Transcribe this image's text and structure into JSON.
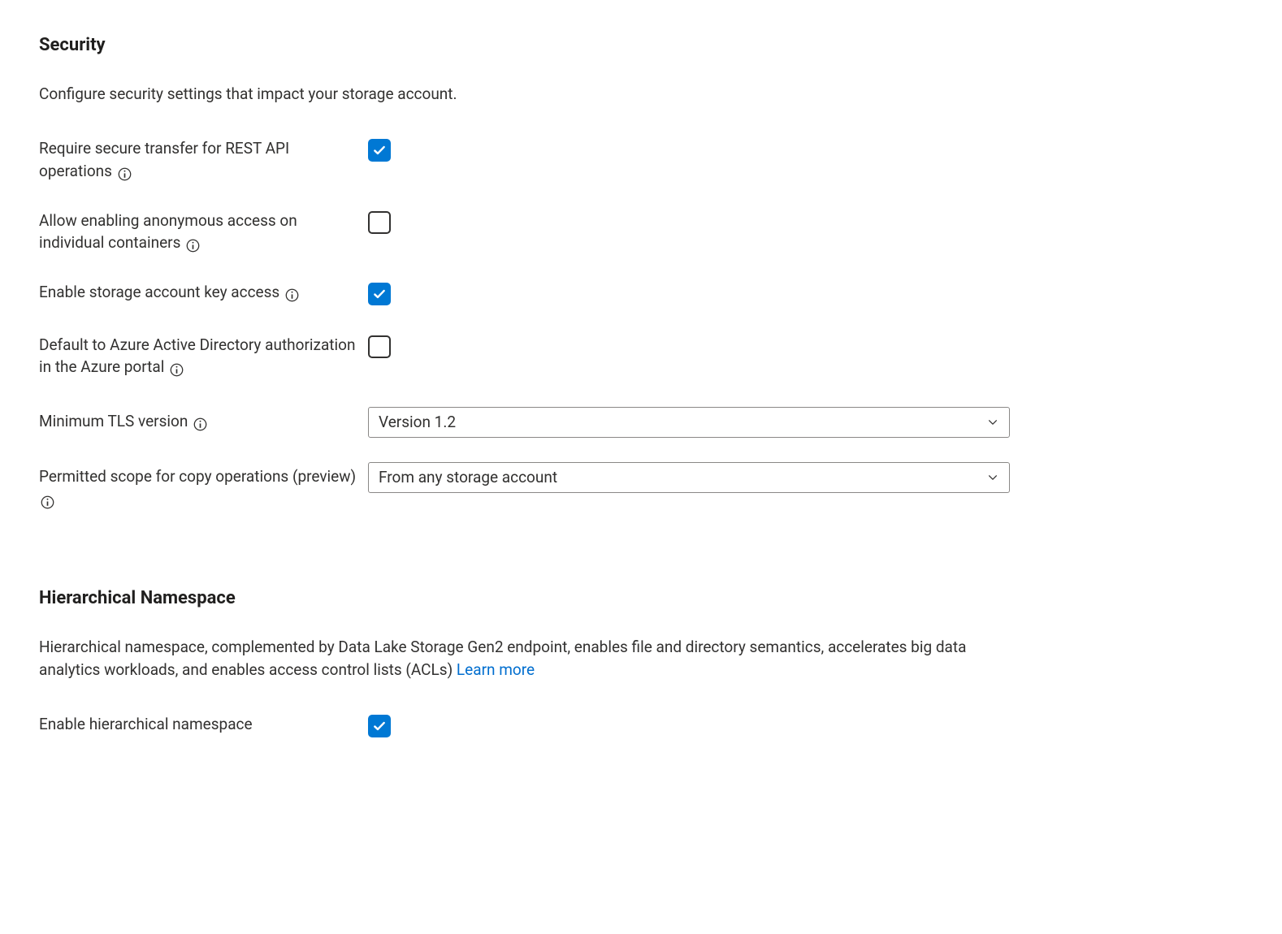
{
  "security": {
    "heading": "Security",
    "description": "Configure security settings that impact your storage account.",
    "fields": {
      "secureTransfer": {
        "label": "Require secure transfer for REST API operations",
        "checked": true
      },
      "anonymousAccess": {
        "label": "Allow enabling anonymous access on individual containers",
        "checked": false
      },
      "keyAccess": {
        "label": "Enable storage account key access",
        "checked": true
      },
      "aadDefault": {
        "label": "Default to Azure Active Directory authorization in the Azure portal",
        "checked": false
      },
      "minTls": {
        "label": "Minimum TLS version",
        "value": "Version 1.2"
      },
      "copyScope": {
        "label": "Permitted scope for copy operations (preview)",
        "value": "From any storage account"
      }
    }
  },
  "hns": {
    "heading": "Hierarchical Namespace",
    "description": "Hierarchical namespace, complemented by Data Lake Storage Gen2 endpoint, enables file and directory semantics, accelerates big data analytics workloads, and enables access control lists (ACLs) ",
    "learnMore": "Learn more",
    "fields": {
      "enableHns": {
        "label": "Enable hierarchical namespace",
        "checked": true
      }
    }
  }
}
